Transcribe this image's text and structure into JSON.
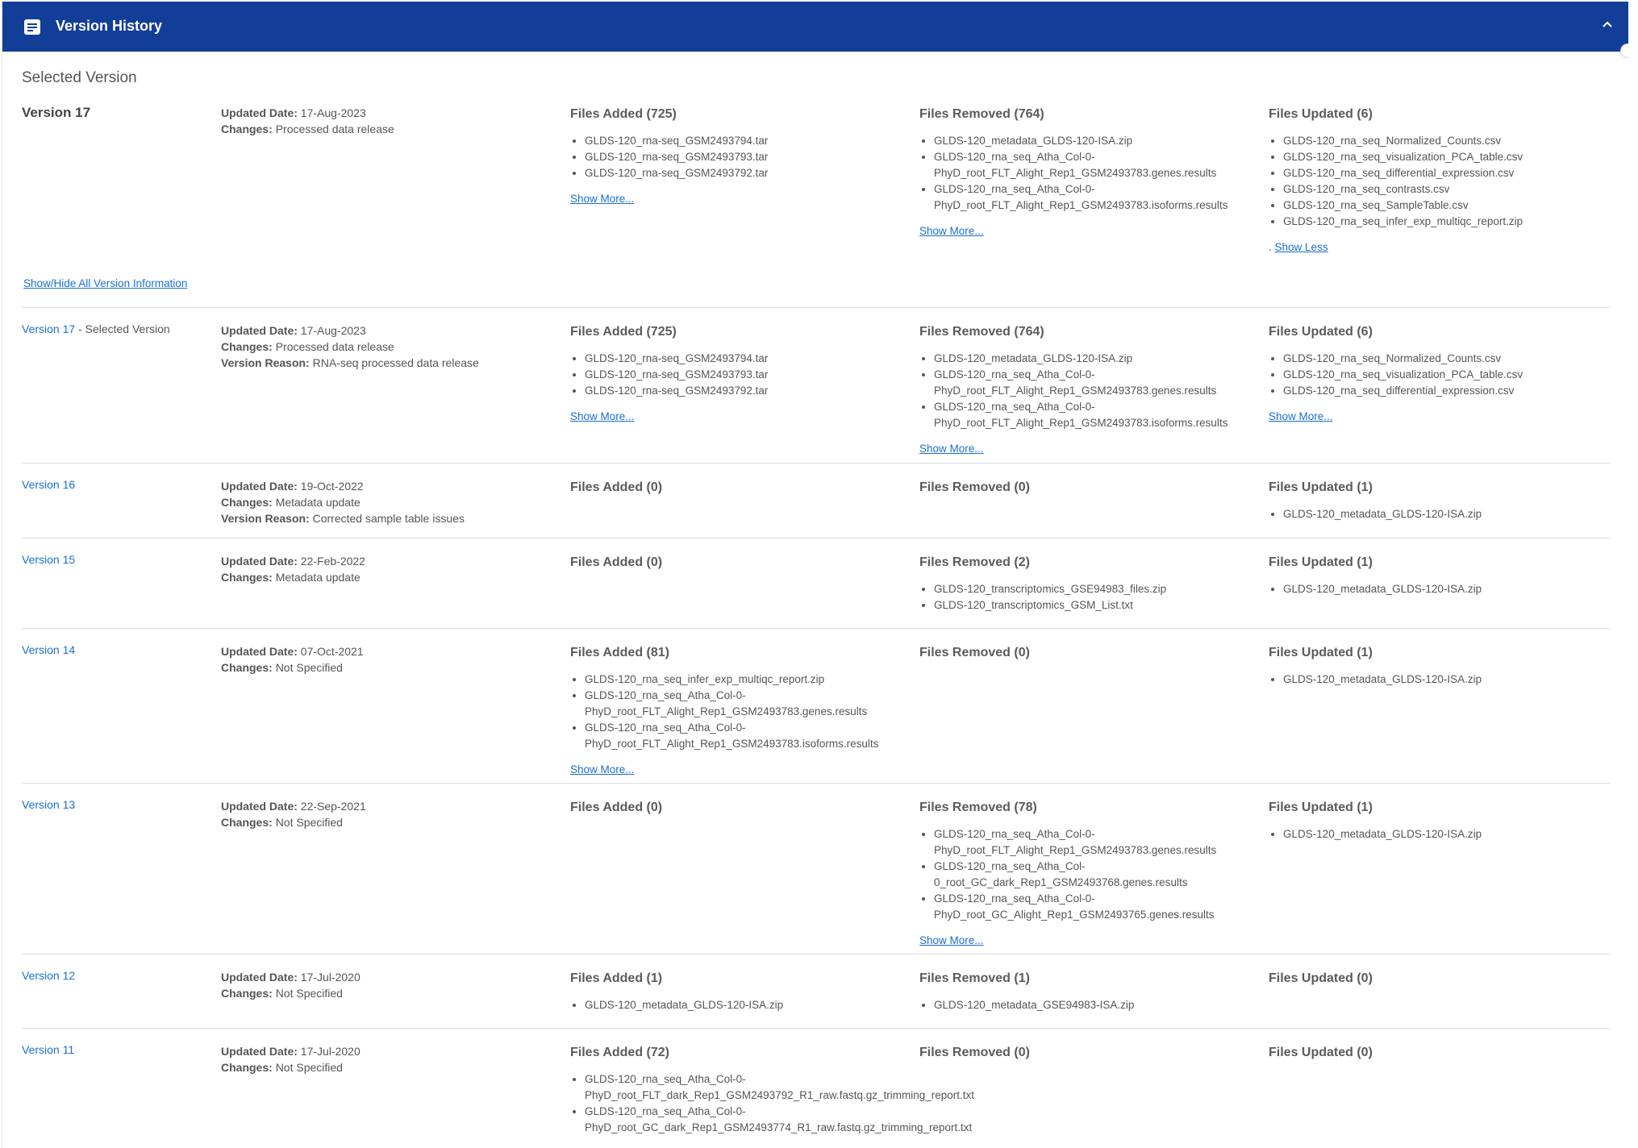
{
  "header": {
    "title": "Version History"
  },
  "selected": {
    "title": "Selected Version",
    "version": "Version 17",
    "updated_label": "Updated Date:",
    "updated": "17-Aug-2023",
    "changes_label": "Changes:",
    "changes": "Processed data release",
    "added": {
      "heading": "Files Added (725)",
      "files": [
        "GLDS-120_rna-seq_GSM2493794.tar",
        "GLDS-120_rna-seq_GSM2493793.tar",
        "GLDS-120_rna-seq_GSM2493792.tar"
      ],
      "more": "Show More..."
    },
    "removed": {
      "heading": "Files Removed (764)",
      "files": [
        "GLDS-120_metadata_GLDS-120-ISA.zip",
        "GLDS-120_rna_seq_Atha_Col-0-PhyD_root_FLT_Alight_Rep1_GSM2493783.genes.results",
        "GLDS-120_rna_seq_Atha_Col-0-PhyD_root_FLT_Alight_Rep1_GSM2493783.isoforms.results"
      ],
      "more": "Show More..."
    },
    "updated_files": {
      "heading": "Files Updated (6)",
      "files": [
        "GLDS-120_rna_seq_Normalized_Counts.csv",
        "GLDS-120_rna_seq_visualization_PCA_table.csv",
        "GLDS-120_rna_seq_differential_expression.csv",
        "GLDS-120_rna_seq_contrasts.csv",
        "GLDS-120_rna_seq_SampleTable.csv",
        "GLDS-120_rna_seq_infer_exp_multiqc_report.zip"
      ],
      "less_prefix": ".",
      "less": "Show Less"
    }
  },
  "toggle_all": "Show/Hide All Version Information",
  "labels": {
    "updated": "Updated Date:",
    "changes": "Changes:",
    "reason": "Version Reason:",
    "more": "Show More..."
  },
  "versions": [
    {
      "name": "Version 17",
      "suffix": " - Selected Version",
      "updated": "17-Aug-2023",
      "changes": "Processed data release",
      "reason": "RNA-seq processed data release",
      "added_h": "Files Added (725)",
      "added": [
        "GLDS-120_rna-seq_GSM2493794.tar",
        "GLDS-120_rna-seq_GSM2493793.tar",
        "GLDS-120_rna-seq_GSM2493792.tar"
      ],
      "removed_h": "Files Removed (764)",
      "removed": [
        "GLDS-120_metadata_GLDS-120-ISA.zip",
        "GLDS-120_rna_seq_Atha_Col-0-PhyD_root_FLT_Alight_Rep1_GSM2493783.genes.results",
        "GLDS-120_rna_seq_Atha_Col-0-PhyD_root_FLT_Alight_Rep1_GSM2493783.isoforms.results"
      ],
      "updated_h": "Files Updated (6)",
      "updated_files": [
        "GLDS-120_rna_seq_Normalized_Counts.csv",
        "GLDS-120_rna_seq_visualization_PCA_table.csv",
        "GLDS-120_rna_seq_differential_expression.csv"
      ]
    },
    {
      "name": "Version 16",
      "updated": "19-Oct-2022",
      "changes": "Metadata update",
      "reason": "Corrected sample table issues",
      "added_h": "Files Added (0)",
      "removed_h": "Files Removed (0)",
      "updated_h": "Files Updated (1)",
      "updated_files": [
        "GLDS-120_metadata_GLDS-120-ISA.zip"
      ]
    },
    {
      "name": "Version 15",
      "updated": "22-Feb-2022",
      "changes": "Metadata update",
      "added_h": "Files Added (0)",
      "removed_h": "Files Removed (2)",
      "removed": [
        "GLDS-120_transcriptomics_GSE94983_files.zip",
        "GLDS-120_transcriptomics_GSM_List.txt"
      ],
      "updated_h": "Files Updated (1)",
      "updated_files": [
        "GLDS-120_metadata_GLDS-120-ISA.zip"
      ]
    },
    {
      "name": "Version 14",
      "updated": "07-Oct-2021",
      "changes": "Not Specified",
      "added_h": "Files Added (81)",
      "added": [
        "GLDS-120_rna_seq_infer_exp_multiqc_report.zip",
        "GLDS-120_rna_seq_Atha_Col-0-PhyD_root_FLT_Alight_Rep1_GSM2493783.genes.results",
        "GLDS-120_rna_seq_Atha_Col-0-PhyD_root_FLT_Alight_Rep1_GSM2493783.isoforms.results"
      ],
      "removed_h": "Files Removed (0)",
      "updated_h": "Files Updated (1)",
      "updated_files": [
        "GLDS-120_metadata_GLDS-120-ISA.zip"
      ]
    },
    {
      "name": "Version 13",
      "updated": "22-Sep-2021",
      "changes": "Not Specified",
      "added_h": "Files Added (0)",
      "removed_h": "Files Removed (78)",
      "removed": [
        "GLDS-120_rna_seq_Atha_Col-0-PhyD_root_FLT_Alight_Rep1_GSM2493783.genes.results",
        "GLDS-120_rna_seq_Atha_Col-0_root_GC_dark_Rep1_GSM2493768.genes.results",
        "GLDS-120_rna_seq_Atha_Col-0-PhyD_root_GC_Alight_Rep1_GSM2493765.genes.results"
      ],
      "updated_h": "Files Updated (1)",
      "updated_files": [
        "GLDS-120_metadata_GLDS-120-ISA.zip"
      ]
    },
    {
      "name": "Version 12",
      "updated": "17-Jul-2020",
      "changes": "Not Specified",
      "added_h": "Files Added (1)",
      "added": [
        "GLDS-120_metadata_GLDS-120-ISA.zip"
      ],
      "removed_h": "Files Removed (1)",
      "removed": [
        "GLDS-120_metadata_GSE94983-ISA.zip"
      ],
      "updated_h": "Files Updated (0)"
    },
    {
      "name": "Version 11",
      "updated": "17-Jul-2020",
      "changes": "Not Specified",
      "added_h": "Files Added (72)",
      "added": [
        "GLDS-120_rna_seq_Atha_Col-0-PhyD_root_FLT_dark_Rep1_GSM2493792_R1_raw.fastq.gz_trimming_report.txt",
        "GLDS-120_rna_seq_Atha_Col-0-PhyD_root_GC_dark_Rep1_GSM2493774_R1_raw.fastq.gz_trimming_report.txt"
      ],
      "removed_h": "Files Removed (0)",
      "updated_h": "Files Updated (0)"
    }
  ]
}
